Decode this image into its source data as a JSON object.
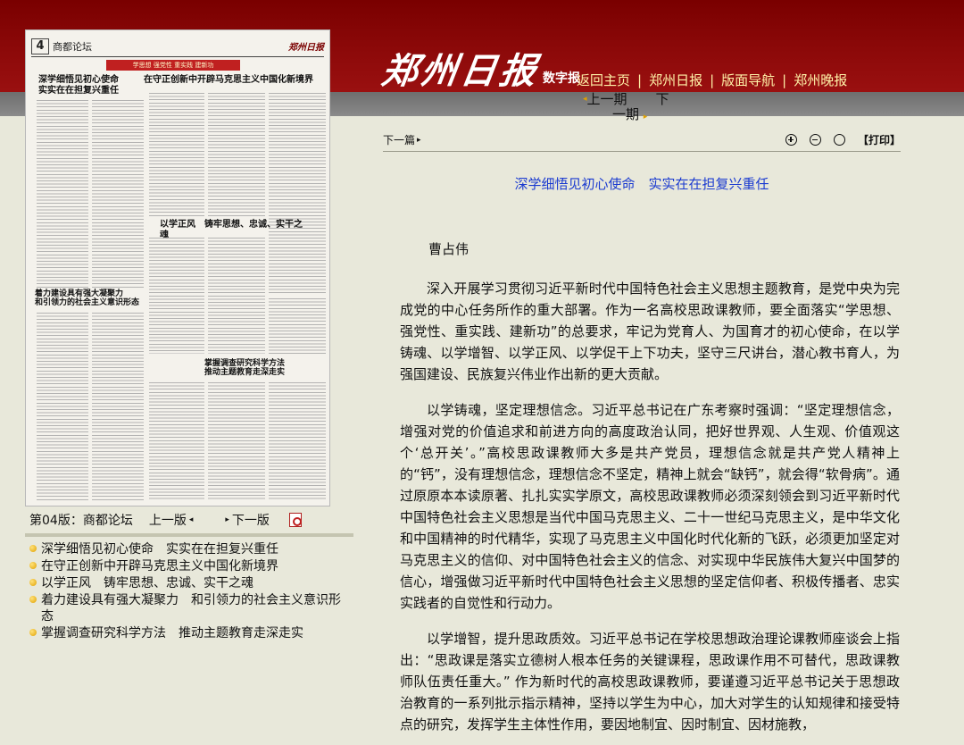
{
  "masthead": {
    "logo": "郑州日报",
    "sub": "数字报"
  },
  "topnav": {
    "items": [
      "返回主页",
      "郑州日报",
      "版面导航",
      "郑州晚报"
    ]
  },
  "prevnext": {
    "prev": "上一期",
    "next_a": "下",
    "next_b": "一期"
  },
  "toolbar": {
    "next_article": "下一篇",
    "print": "【打印】"
  },
  "thumbnail": {
    "page_num": "4",
    "section": "商都论坛",
    "brand": "郑州日报",
    "banner": "学思想 强党性 重实践 建新功",
    "headlines": [
      "深学细悟见初心使命\n实实在在担复兴重任",
      "在守正创新中开辟马克思主义中国化新境界",
      "以学正风　铸牢思想、忠诚、实干之魂",
      "着力建设具有强大凝聚力\n和引领力的社会主义意识形态",
      "掌握调查研究科学方法\n推动主题教育走深走实"
    ]
  },
  "pager": {
    "page_label": "第04版：商都论坛",
    "prev_page": "上一版",
    "next_page": "下一版"
  },
  "article_list": [
    "深学细悟见初心使命　实实在在担复兴重任",
    "在守正创新中开辟马克思主义中国化新境界",
    "以学正风　铸牢思想、忠诚、实干之魂",
    "着力建设具有强大凝聚力　和引领力的社会主义意识形态",
    "掌握调查研究科学方法　推动主题教育走深走实"
  ],
  "article": {
    "title": "深学细悟见初心使命　实实在在担复兴重任",
    "author": "曹占伟",
    "paragraphs": [
      "深入开展学习贯彻习近平新时代中国特色社会主义思想主题教育，是党中央为完成党的中心任务所作的重大部署。作为一名高校思政课教师，要全面落实“学思想、强党性、重实践、建新功”的总要求，牢记为党育人、为国育才的初心使命，在以学铸魂、以学增智、以学正风、以学促干上下功夫，坚守三尺讲台，潜心教书育人，为强国建设、民族复兴伟业作出新的更大贡献。",
      "以学铸魂，坚定理想信念。习近平总书记在广东考察时强调：“坚定理想信念，增强对党的价值追求和前进方向的高度政治认同，把好世界观、人生观、价值观这个‘总开关’。”高校思政课教师大多是共产党员，理想信念就是共产党人精神上的“钙”，没有理想信念，理想信念不坚定，精神上就会“缺钙”，就会得“软骨病”。通过原原本本读原著、扎扎实实学原文，高校思政课教师必须深刻领会到习近平新时代中国特色社会主义思想是当代中国马克思主义、二十一世纪马克思主义，是中华文化和中国精神的时代精华，实现了马克思主义中国化时代化新的飞跃，必须更加坚定对马克思主义的信仰、对中国特色社会主义的信念、对实现中华民族伟大复兴中国梦的信心，增强做习近平新时代中国特色社会主义思想的坚定信仰者、积极传播者、忠实实践者的自觉性和行动力。",
      "以学增智，提升思政质效。习近平总书记在学校思想政治理论课教师座谈会上指出：“思政课是落实立德树人根本任务的关键课程，思政课作用不可替代，思政课教师队伍责任重大。” 作为新时代的高校思政课教师，要谨遵习近平总书记关于思想政治教育的一系列批示指示精神，坚持以学生为中心，加大对学生的认知规律和接受特点的研究，发挥学生主体性作用，要因地制宜、因时制宜、因材施教，"
    ]
  }
}
